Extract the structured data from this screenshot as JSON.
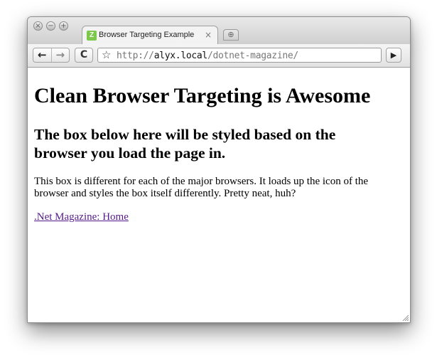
{
  "tab": {
    "title": "Browser Targeting Example",
    "close": "×",
    "favicon": "Z"
  },
  "toolbar": {
    "back_icon": "←",
    "forward_icon": "→",
    "reload_icon": "C",
    "star_icon": "☆",
    "url_scheme": "http://",
    "url_host": "alyx.local",
    "url_path": "/dotnet-magazine/",
    "go_icon": "▶"
  },
  "page": {
    "heading": "Clean Browser Targeting is Awesome",
    "subheading": "The box below here will be styled based on the browser you load the page in.",
    "description": "This box is different for each of the major browsers. It loads up the icon of the browser and styles the box itself differently. Pretty neat, huh?",
    "link": ".Net Magazine: Home"
  },
  "colors": {
    "link_visited": "#551a8b",
    "favicon": "#7cc84a"
  }
}
